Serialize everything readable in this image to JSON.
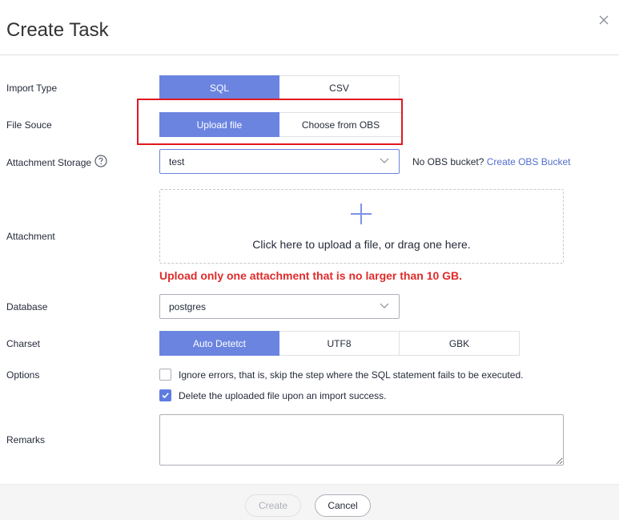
{
  "dialog": {
    "title": "Create Task"
  },
  "import_type": {
    "label": "Import Type",
    "options": [
      "SQL",
      "CSV"
    ],
    "selected": "SQL"
  },
  "file_source": {
    "label": "File Souce",
    "options": [
      "Upload file",
      "Choose from OBS"
    ],
    "selected": "Upload file"
  },
  "attachment_storage": {
    "label": "Attachment Storage",
    "value": "test",
    "note": "No OBS bucket?",
    "link": "Create OBS Bucket"
  },
  "attachment": {
    "label": "Attachment",
    "upload_text": "Click here to upload a file, or drag one here.",
    "warning": "Upload only one attachment that is no larger than 10 GB."
  },
  "database": {
    "label": "Database",
    "value": "postgres"
  },
  "charset": {
    "label": "Charset",
    "options": [
      "Auto Detetct",
      "UTF8",
      "GBK"
    ],
    "selected": "Auto Detetct"
  },
  "options": {
    "label": "Options",
    "items": [
      {
        "text": "Ignore errors, that is, skip the step where the SQL statement fails to be executed.",
        "checked": false
      },
      {
        "text": "Delete the uploaded file upon an import success.",
        "checked": true
      }
    ]
  },
  "remarks": {
    "label": "Remarks",
    "value": ""
  },
  "footer": {
    "create_label": "Create",
    "cancel_label": "Cancel"
  },
  "colors": {
    "primary": "#6b84e0",
    "warning": "#e02b2b",
    "highlight": "#e0191f",
    "link": "#526ecc"
  },
  "icons": {
    "close": "close-icon",
    "help": "help-icon",
    "chevron": "chevron-down-icon",
    "plus": "plus-icon",
    "check": "check-icon"
  }
}
